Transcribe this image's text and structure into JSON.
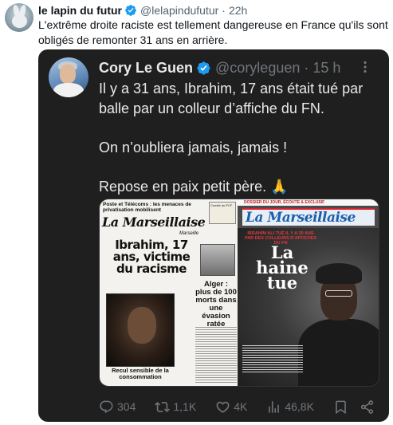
{
  "outer_tweet": {
    "author_name": "le lapin du futur",
    "handle": "@lelapindufutur",
    "time": "22h",
    "separator": "·",
    "text": "L'extrême droite raciste est tellement dangereuse en France qu'ils sont obligés de remonter 31 ans en arrière."
  },
  "quoted_tweet": {
    "author_name": "Cory Le Guen",
    "handle": "@coryleguen",
    "time": "15 h",
    "separator": "·",
    "paragraphs": [
      "Il y a 31 ans, Ibrahim, 17 ans était tué par balle par un colleur d’affiche du FN.",
      "On n’oubliera jamais, jamais !",
      "Repose en paix petit père. 🙏"
    ],
    "media": {
      "left_newspaper": {
        "top_headline": "Poste et Télécoms : les menaces de privatisation mobilisent",
        "side_box": "Comité du PCF",
        "brand": "La Marseillaise",
        "edition": "Marseille",
        "headline": "Ibrahim, 17 ans, victime du racisme",
        "side_headline": "Alger : plus de 100 morts dans une évasion ratée",
        "photo_caption": "Recul sensible de la consommation"
      },
      "right_newspaper": {
        "top_banner": "DOSSIER DU JOUR, ÉCOUTE & EXCLUSIF",
        "brand": "La Marseillaise",
        "subheadline": "IBRAHIM ALI TUÉ IL Y A 30 ANS PAR DES COLLEURS D'AFFICHES DU FN",
        "headline": "La haine tue"
      }
    },
    "stats": {
      "replies": "304",
      "reposts": "1,1K",
      "likes": "4K",
      "views": "46,8K"
    }
  },
  "colors": {
    "card_bg": "#1f1f1f",
    "verified_blue": "#1d9bf0",
    "muted": "#71767b",
    "text_dark": "#e7e9ea"
  },
  "icons": {
    "verified": "verified-badge-icon",
    "more": "more-options-icon",
    "reply": "reply-icon",
    "repost": "repost-icon",
    "like": "heart-icon",
    "views": "views-icon",
    "bookmark": "bookmark-icon",
    "share": "share-icon"
  }
}
